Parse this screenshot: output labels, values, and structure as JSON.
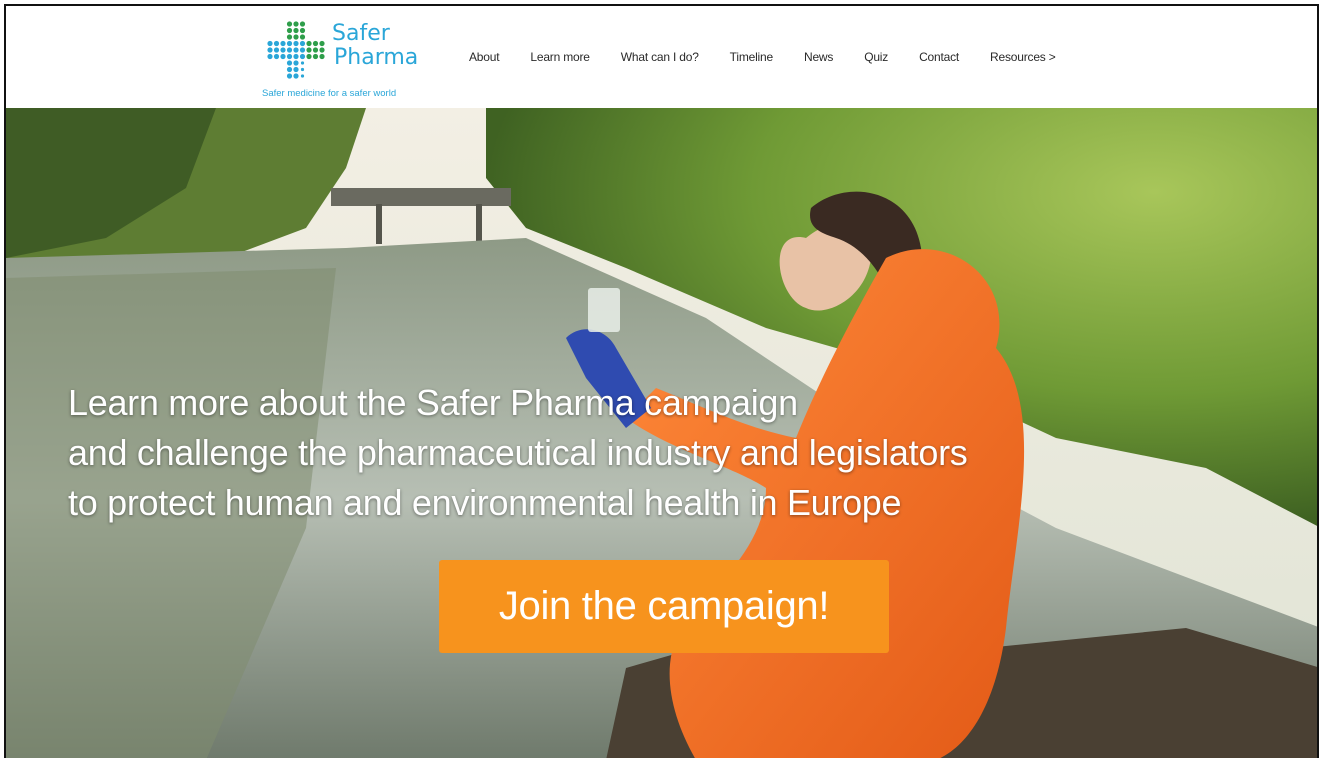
{
  "brand": {
    "name_line1": "Safer",
    "name_line2": "Pharma",
    "tagline": "Safer medicine for a safer world",
    "colors": {
      "brand_blue": "#2aa6d8",
      "brand_green": "#2e9e4a",
      "cta_orange": "#f7931d"
    }
  },
  "nav": {
    "items": [
      {
        "label": "About"
      },
      {
        "label": "Learn more"
      },
      {
        "label": "What can I do?"
      },
      {
        "label": "Timeline"
      },
      {
        "label": "News"
      },
      {
        "label": "Quiz"
      },
      {
        "label": "Contact"
      },
      {
        "label": "Resources >"
      }
    ]
  },
  "hero": {
    "headline": [
      "Learn more about the Safer Pharma campaign",
      "and challenge the pharmaceutical industry and legislators",
      "to protect human and environmental health in Europe"
    ],
    "cta_label": "Join the campaign!",
    "image": "photo of a woman in an orange protective suit holding a water sample by a river"
  }
}
